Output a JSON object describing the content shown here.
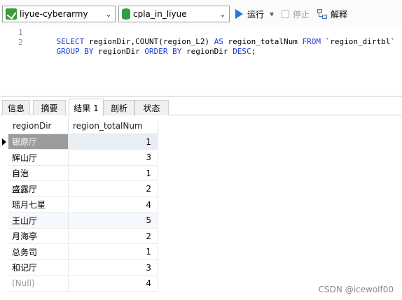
{
  "toolbar": {
    "connection": "liyue-cyberarmy",
    "database": "cpla_in_liyue",
    "run_label": "运行",
    "stop_label": "停止",
    "explain_label": "解释"
  },
  "editor": {
    "line_numbers": [
      "1",
      "2"
    ],
    "line1": [
      {
        "t": "SELECT",
        "k": 1
      },
      {
        "t": " regionDir,COUNT(region_L2) ",
        "k": 0
      },
      {
        "t": "AS",
        "k": 1
      },
      {
        "t": " region_totalNum ",
        "k": 0
      },
      {
        "t": "FROM",
        "k": 1
      },
      {
        "t": " `region_dirtbl`",
        "k": 0
      }
    ],
    "line2": [
      {
        "t": "GROUP BY",
        "k": 1
      },
      {
        "t": " regionDir ",
        "k": 0
      },
      {
        "t": "ORDER BY",
        "k": 1
      },
      {
        "t": " regionDir ",
        "k": 0
      },
      {
        "t": "DESC",
        "k": 1
      },
      {
        "t": ";",
        "k": 0
      }
    ]
  },
  "tabs": [
    "信息",
    "摘要",
    "结果 1",
    "剖析",
    "状态"
  ],
  "grid": {
    "columns": [
      "regionDir",
      "region_totalNum"
    ],
    "rows": [
      {
        "dir": "银原厅",
        "num": "1"
      },
      {
        "dir": "辉山厅",
        "num": "3"
      },
      {
        "dir": "自治",
        "num": "1"
      },
      {
        "dir": "盛露厅",
        "num": "2"
      },
      {
        "dir": "瑶月七星",
        "num": "4"
      },
      {
        "dir": "王山厅",
        "num": "5"
      },
      {
        "dir": "月海亭",
        "num": "2"
      },
      {
        "dir": "总务司",
        "num": "1"
      },
      {
        "dir": "和记厅",
        "num": "3"
      },
      {
        "dir": "(Null)",
        "num": "4"
      }
    ]
  },
  "watermark": "CSDN @icewolf00"
}
